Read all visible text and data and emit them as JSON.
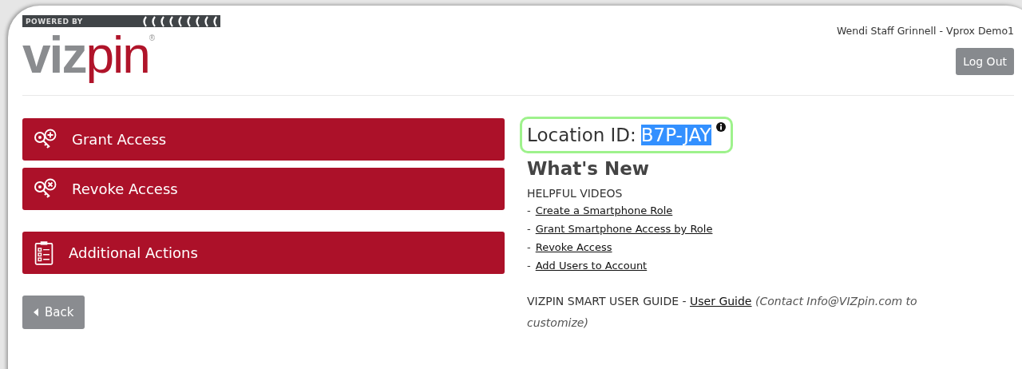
{
  "logo": {
    "tagline": "POWERED BY",
    "word_gray": "viz",
    "word_red": "pin",
    "mark": "®"
  },
  "user": "Wendi Staff Grinnell - Vprox Demo1",
  "logout": "Log Out",
  "actions": [
    {
      "label": "Grant Access",
      "kind": "grant"
    },
    {
      "label": "Revoke Access",
      "kind": "revoke"
    },
    {
      "label": "Additional Actions",
      "kind": "list"
    }
  ],
  "back": "Back",
  "location": {
    "label": "Location ID:",
    "value": "B7P-JAY",
    "highlighted": true
  },
  "whats_new": "What's New",
  "videos_heading": "HELPFUL VIDEOS",
  "videos": [
    {
      "bullet": "-",
      "label": "Create a Smartphone Role"
    },
    {
      "bullet": "-",
      "label": "Grant Smartphone Access by Role"
    },
    {
      "bullet": "-",
      "label": "Revoke Access"
    },
    {
      "bullet": "-",
      "label": "Add Users to Account"
    }
  ],
  "guide": {
    "prefix": "VIZPIN SMART USER GUIDE -",
    "link": "User Guide",
    "note": "(Contact Info@VIZpin.com to customize)"
  }
}
